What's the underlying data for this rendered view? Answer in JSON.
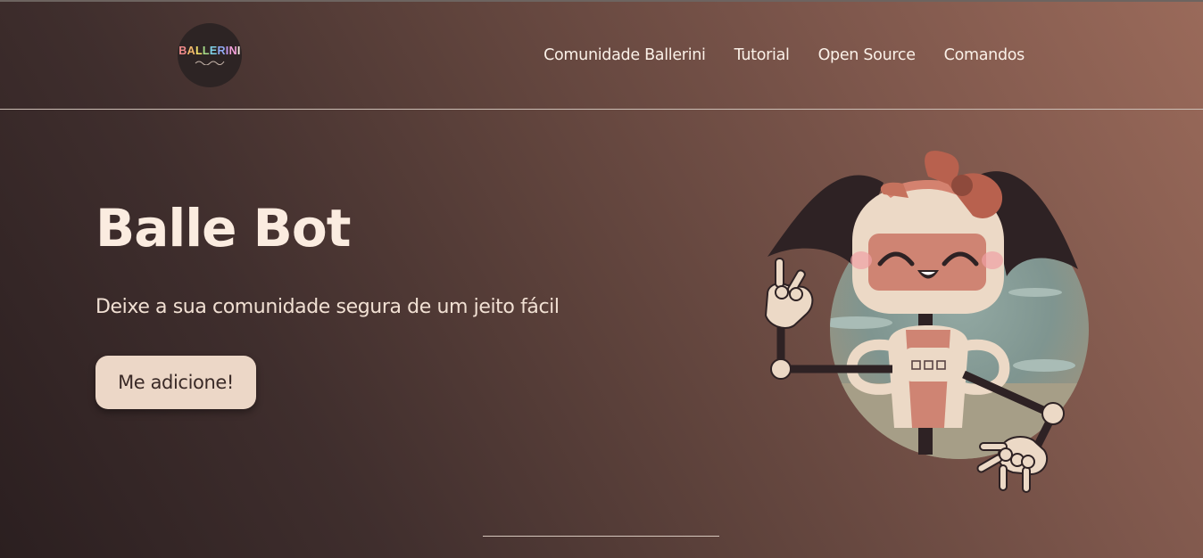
{
  "logo": {
    "text": "BALLERINI",
    "letters": [
      "B",
      "A",
      "L",
      "L",
      "E",
      "R",
      "I",
      "N",
      "I"
    ]
  },
  "nav": {
    "items": [
      {
        "label": "Comunidade Ballerini"
      },
      {
        "label": "Tutorial"
      },
      {
        "label": "Open Source"
      },
      {
        "label": "Comandos"
      }
    ]
  },
  "hero": {
    "title": "Balle Bot",
    "subtitle": "Deixe a sua comunidade segura de um jeito fácil",
    "cta_label": "Me adicione!"
  },
  "colors": {
    "background_dark": "#2b1f20",
    "background_light": "#9a6a5a",
    "text": "#fbeee4",
    "button_bg": "#ecd7c7",
    "robot_cream": "#ecd9c6",
    "robot_pink": "#d4826f",
    "robot_dark": "#2e2224",
    "bow": "#b8614e"
  }
}
